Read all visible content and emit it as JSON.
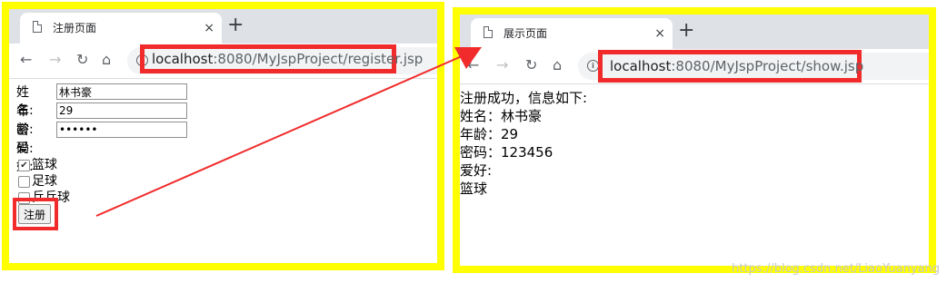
{
  "left_window": {
    "tab_title": "注册页面",
    "tab_close": "×",
    "new_tab": "+",
    "nav": {
      "back": "←",
      "forward": "→",
      "reload": "↻",
      "home": "⌂"
    },
    "url_host": "localhost",
    "url_path": ":8080/MyJspProject/register.jsp",
    "form": {
      "name_label": "姓名:",
      "name_value": "林书豪",
      "age_label": "年龄:",
      "age_value": "29",
      "password_label": "密码:",
      "password_value": "123456",
      "hobby_label": "爱好:",
      "hobbies": [
        {
          "label": "篮球",
          "checked": true
        },
        {
          "label": "足球",
          "checked": false
        },
        {
          "label": "乒乓球",
          "checked": false
        }
      ],
      "submit_label": "注册"
    }
  },
  "right_window": {
    "tab_title": "展示页面",
    "tab_close": "×",
    "new_tab": "+",
    "nav": {
      "back": "←",
      "forward": "→",
      "reload": "↻",
      "home": "⌂"
    },
    "url_host": "localhost",
    "url_path": ":8080/MyJspProject/show.jsp",
    "lines": [
      "注册成功，信息如下:",
      "姓名：林书豪",
      "年龄：29",
      "密码：123456",
      "爱好:",
      "篮球"
    ]
  },
  "watermark": "https://blog.csdn.net/LiaoYuanyang",
  "colors": {
    "highlight_border": "#ffff00",
    "callout_red": "#f12b2b"
  },
  "icons": [
    "document-icon",
    "close-icon",
    "plus-icon",
    "back-arrow-icon",
    "forward-arrow-icon",
    "reload-icon",
    "home-icon",
    "info-icon"
  ]
}
